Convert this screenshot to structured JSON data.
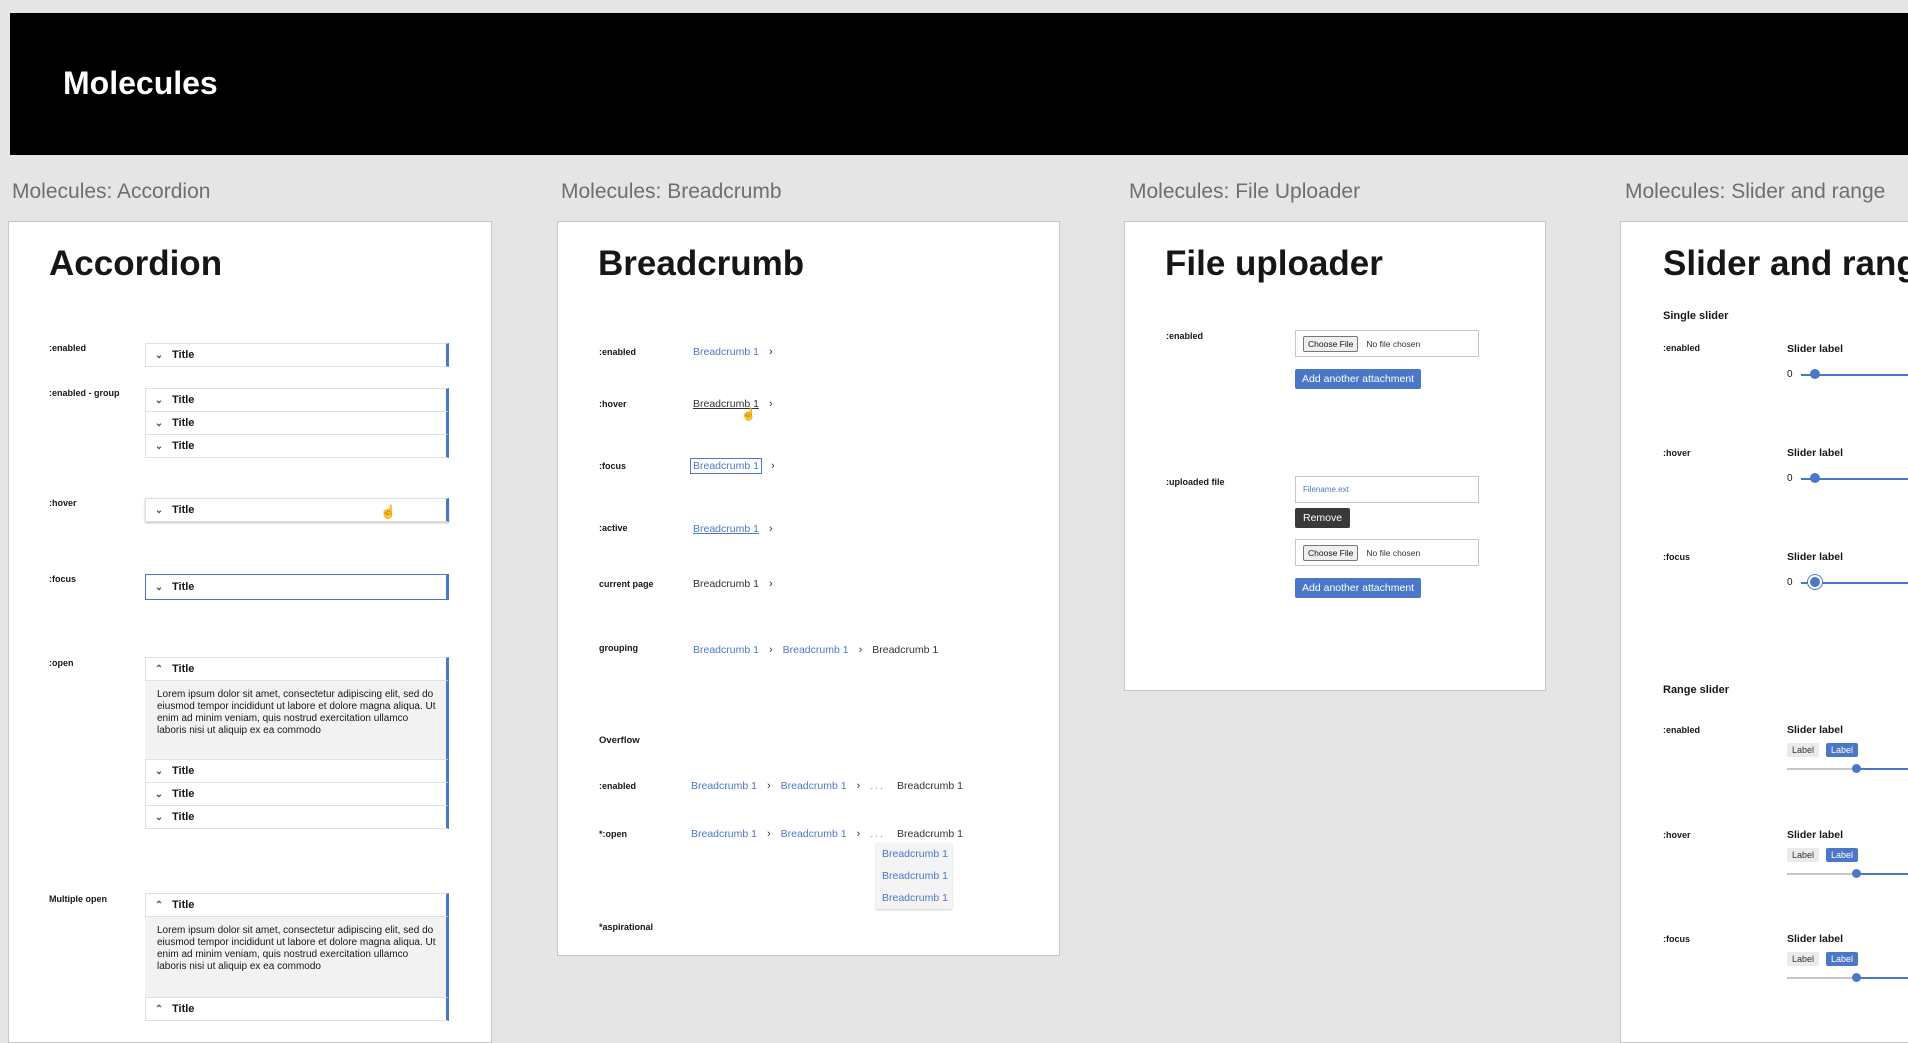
{
  "header": {
    "title": "Molecules"
  },
  "sections": {
    "accordion": "Molecules: Accordion",
    "breadcrumb": "Molecules: Breadcrumb",
    "file_uploader": "Molecules: File Uploader",
    "slider": "Molecules: Slider and range"
  },
  "accordion": {
    "title": "Accordion",
    "states": [
      ":enabled",
      ":enabled - group",
      ":hover",
      ":focus",
      ":open",
      "Multiple open"
    ],
    "item_title": "Title",
    "body_text": "Lorem ipsum dolor sit amet, consectetur adipiscing elit, sed do eiusmod tempor incididunt ut labore et dolore magna aliqua. Ut enim ad minim veniam, quis nostrud exercitation ullamco laboris nisi ut aliquip ex ea commodo"
  },
  "breadcrumb": {
    "title": "Breadcrumb",
    "states": [
      ":enabled",
      ":hover",
      ":focus",
      ":active",
      "current page",
      "grouping"
    ],
    "overflow_heading": "Overflow",
    "overflow_states": [
      ":enabled",
      "*:open"
    ],
    "aspirational": "*aspirational",
    "crumb": "Breadcrumb 1",
    "ellipsis": "..."
  },
  "file_uploader": {
    "title": "File uploader",
    "states": [
      ":enabled",
      ":uploaded file"
    ],
    "choose_label": "Choose File",
    "no_file": "No file chosen",
    "add_button": "Add another attachment",
    "filename": "Filename.ext",
    "remove_button": "Remove"
  },
  "slider": {
    "title": "Slider and range",
    "single_heading": "Single slider",
    "range_heading": "Range slider",
    "states": [
      ":enabled",
      ":hover",
      ":focus"
    ],
    "label": "Slider label",
    "min_value": "0",
    "tag_label": "Label",
    "single_value_fraction": 0.1,
    "range_value_fraction": 0.45
  },
  "colors": {
    "accent": "#4b77c9",
    "header_bg": "#000000",
    "page_bg": "#e5e5e5"
  }
}
